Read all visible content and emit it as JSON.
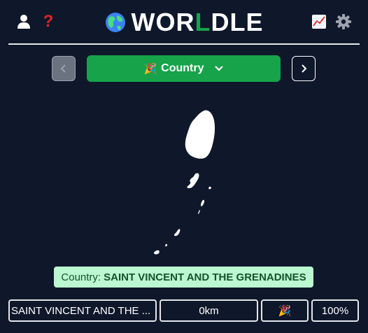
{
  "header": {
    "title_pre": "WOR",
    "title_mid": "L",
    "title_post": "DLE",
    "help_glyph": "?",
    "accent_color": "#16a34a",
    "help_color": "#dc2626"
  },
  "mode": {
    "emoji": "🎉",
    "label": "Country"
  },
  "answer": {
    "prefix": "Country:",
    "name": "SAINT VINCENT AND THE GRENADINES"
  },
  "guesses": [
    {
      "country": "SAINT VINCENT AND THE ...",
      "distance": "0km",
      "direction": "🎉",
      "proximity": "100%"
    }
  ]
}
